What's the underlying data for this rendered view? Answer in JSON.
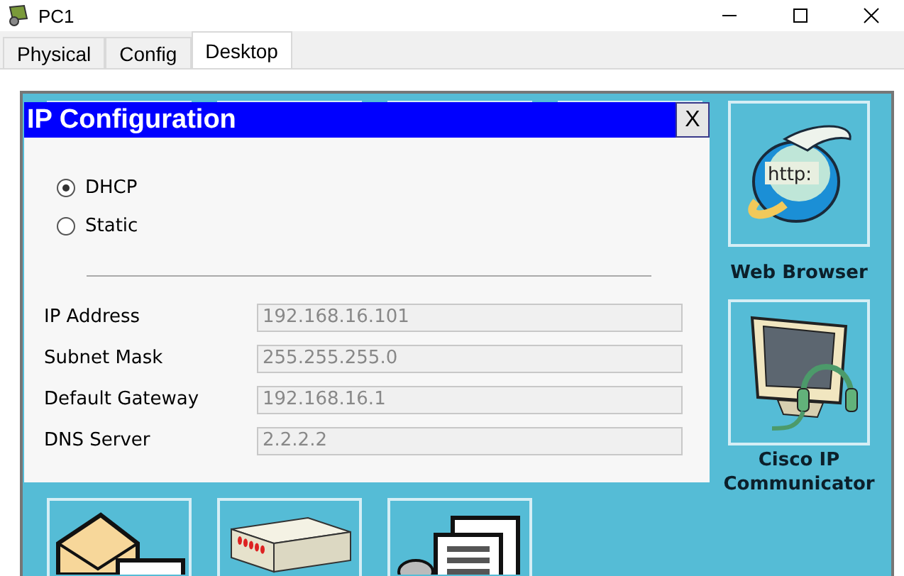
{
  "window": {
    "title": "PC1"
  },
  "tabs": [
    {
      "label": "Physical",
      "selected": false
    },
    {
      "label": "Config",
      "selected": false
    },
    {
      "label": "Desktop",
      "selected": true
    }
  ],
  "desktop": {
    "apps": [
      {
        "label": "Web Browser",
        "badge": "http:"
      },
      {
        "label": "Cisco IP Communicator"
      }
    ]
  },
  "dialog": {
    "title": "IP Configuration",
    "close": "X",
    "modes": [
      {
        "label": "DHCP",
        "selected": true
      },
      {
        "label": "Static",
        "selected": false
      }
    ],
    "fields": [
      {
        "label": "IP Address",
        "value": "192.168.16.101",
        "disabled": true
      },
      {
        "label": "Subnet Mask",
        "value": "255.255.255.0",
        "disabled": true
      },
      {
        "label": "Default Gateway",
        "value": "192.168.16.1",
        "disabled": true
      },
      {
        "label": "DNS Server",
        "value": "2.2.2.2",
        "disabled": true
      }
    ]
  }
}
